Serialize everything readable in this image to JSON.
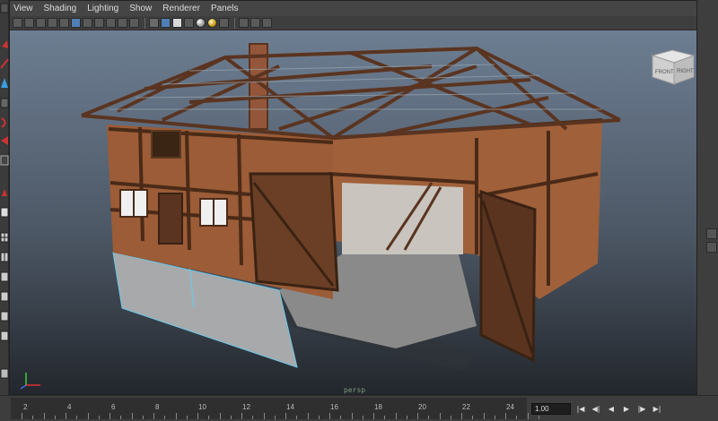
{
  "menu": [
    "View",
    "Shading",
    "Lighting",
    "Show",
    "Renderer",
    "Panels"
  ],
  "viewport": {
    "camera": "persp",
    "viewcube": {
      "front": "FRONT",
      "right": "RIGHT"
    }
  },
  "timeline": {
    "ticks": [
      "2",
      "4",
      "6",
      "8",
      "10",
      "12",
      "14",
      "16",
      "18",
      "20",
      "22",
      "24"
    ],
    "current_frame": "1.00"
  },
  "playback": {
    "go_start": "|◀",
    "step_back": "◀|",
    "play_back": "◀",
    "play_forward": "▶",
    "step_forward": "|▶",
    "go_end": "▶|"
  },
  "colors": {
    "viewport_top": "#6d7e92",
    "viewport_bottom": "#23272d",
    "panel_bg": "#444444",
    "selection": "#6ec8e8"
  }
}
